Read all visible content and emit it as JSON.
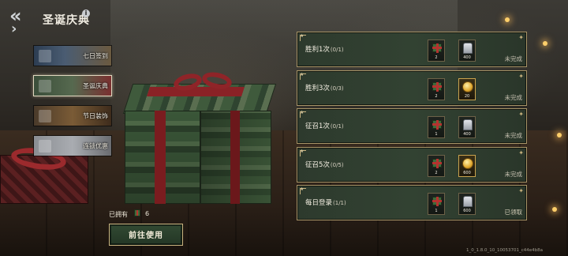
{
  "header": {
    "title": "圣诞庆典",
    "back_icon": "double-chevron-left-icon",
    "info_icon": "info-icon",
    "info_glyph": "i"
  },
  "sidebar": {
    "items": [
      {
        "label": "七日签到",
        "active": false
      },
      {
        "label": "圣诞庆典",
        "active": true
      },
      {
        "label": "节日装饰",
        "active": false
      },
      {
        "label": "连锁优惠",
        "active": false
      }
    ]
  },
  "tasks": [
    {
      "name": "胜利1次",
      "progress": "(0/1)",
      "status": "未完成",
      "rewards": [
        {
          "icon": "gift-box-icon",
          "qty": "2"
        },
        {
          "icon": "dog-tag-icon",
          "qty": "400"
        }
      ]
    },
    {
      "name": "胜利3次",
      "progress": "(0/3)",
      "status": "未完成",
      "rewards": [
        {
          "icon": "gift-box-icon",
          "qty": "2"
        },
        {
          "icon": "gold-coin-icon",
          "qty": "20"
        }
      ]
    },
    {
      "name": "征召1次",
      "progress": "(0/1)",
      "status": "未完成",
      "rewards": [
        {
          "icon": "gift-box-icon",
          "qty": "1"
        },
        {
          "icon": "dog-tag-icon",
          "qty": "400"
        }
      ]
    },
    {
      "name": "征召5次",
      "progress": "(0/5)",
      "status": "未完成",
      "rewards": [
        {
          "icon": "gift-box-icon",
          "qty": "2"
        },
        {
          "icon": "gold-coin-icon",
          "qty": "600"
        }
      ]
    },
    {
      "name": "每日登录",
      "progress": "(1/1)",
      "status": "已领取",
      "rewards": [
        {
          "icon": "gift-box-icon",
          "qty": "1"
        },
        {
          "icon": "dog-tag-icon",
          "qty": "600"
        }
      ]
    }
  ],
  "inventory": {
    "owned_label": "已拥有",
    "owned_icon": "gift-box-icon",
    "owned_count": "6"
  },
  "actions": {
    "use_label": "前往使用"
  },
  "footer": {
    "version": "1_0_1.8.0_10_10053701_c44e4b8a"
  },
  "colors": {
    "accent_gold": "#c8b27e",
    "panel_green": "#2d3a2d",
    "ribbon_red": "#8a2226"
  }
}
